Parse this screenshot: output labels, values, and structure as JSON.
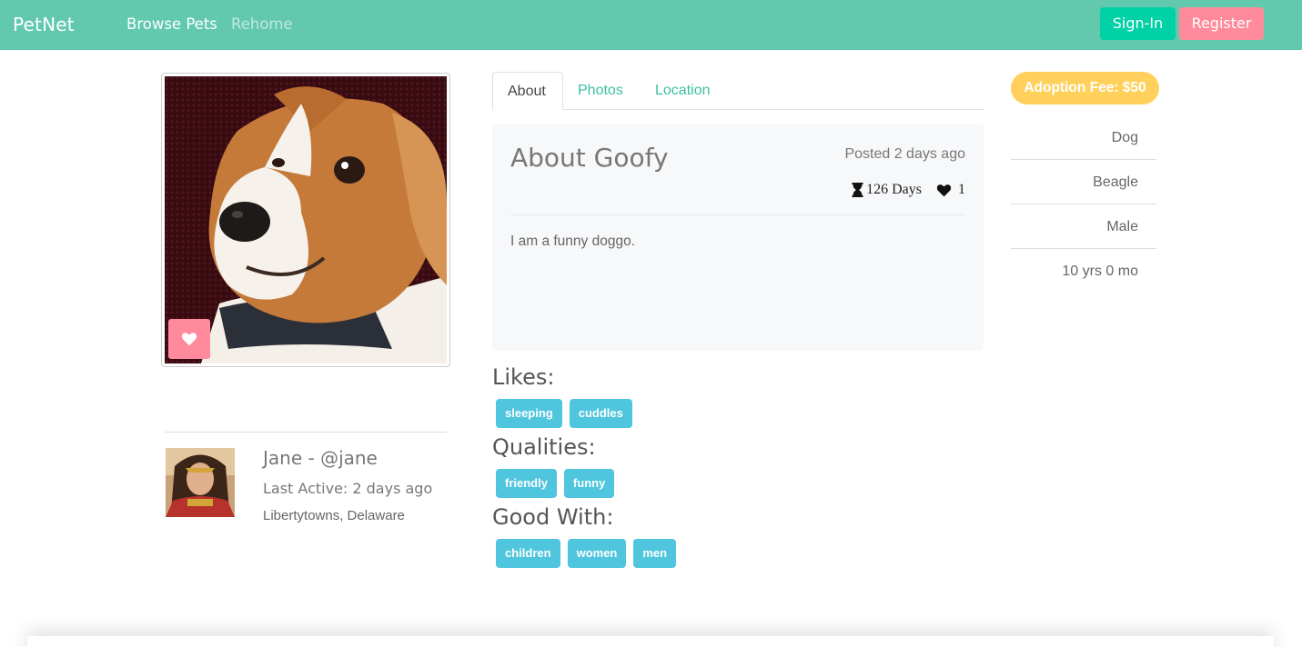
{
  "navbar": {
    "brand": "PetNet",
    "links": [
      "Browse Pets",
      "Rehome"
    ],
    "signin_label": "Sign-In",
    "register_label": "Register",
    "color": "#62c9ae"
  },
  "photo": {
    "alt_subject": "dog photo",
    "favorite_icon": "heart-icon"
  },
  "owner": {
    "name": "Jane - @jane",
    "last_active": "Last Active: 2 days ago",
    "location": "Libertytowns, Delaware"
  },
  "tabs": [
    {
      "label": "About",
      "active": true
    },
    {
      "label": "Photos",
      "active": false
    },
    {
      "label": "Location",
      "active": false
    }
  ],
  "about": {
    "title": "About Goofy",
    "posted": "Posted 2 days ago",
    "days": "126 Days",
    "likes_count": "1",
    "description": "I am a funny doggo."
  },
  "sections": {
    "likes": {
      "title": "Likes:",
      "tags": [
        "sleeping",
        "cuddles"
      ]
    },
    "qualities": {
      "title": "Qualities:",
      "tags": [
        "friendly",
        "funny"
      ]
    },
    "good_with": {
      "title": "Good With:",
      "tags": [
        "children",
        "women",
        "men"
      ]
    }
  },
  "details": {
    "fee": "Adoption Fee: $50",
    "attributes": [
      "Dog",
      "Beagle",
      "Male",
      "10 yrs 0 mo"
    ]
  },
  "colors": {
    "accent": "#3cbfa3",
    "tag": "#4fc6dd",
    "fee": "#ffd15c",
    "register": "#ff8a9c",
    "signin": "#00d1a6"
  }
}
